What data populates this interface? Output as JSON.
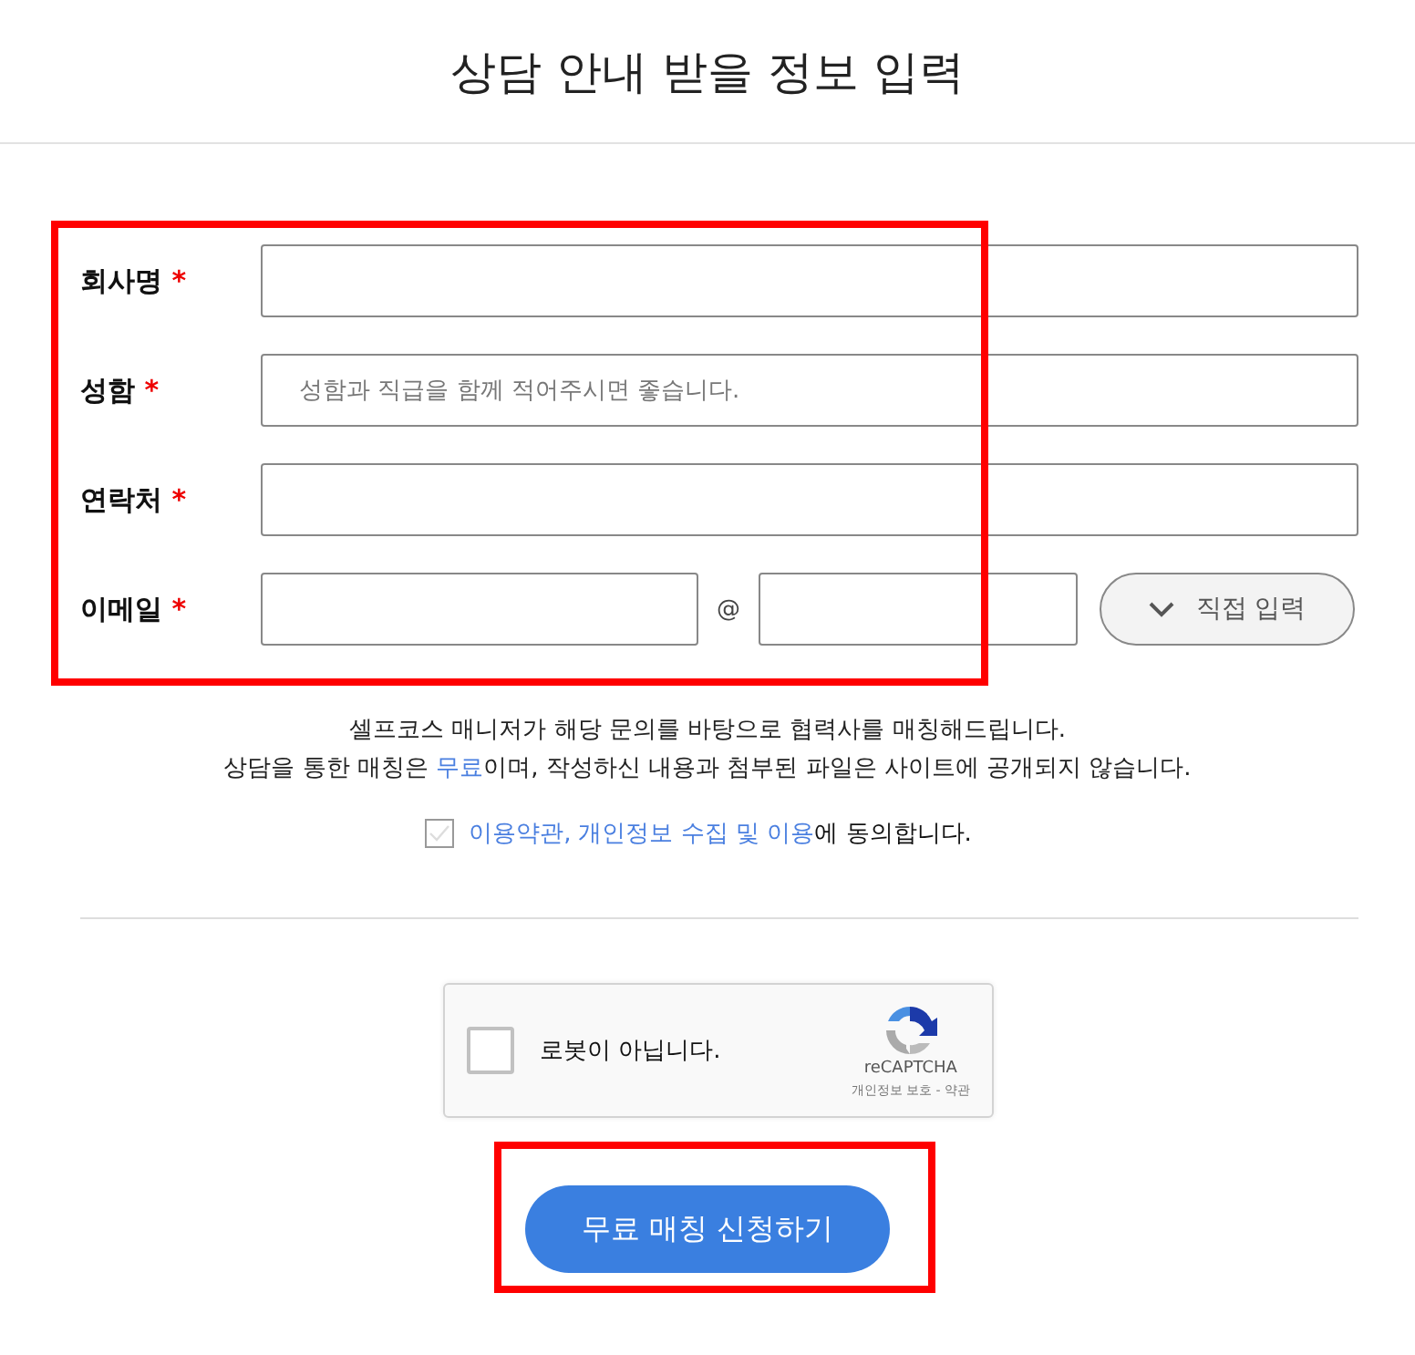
{
  "title": "상담 안내 받을 정보 입력",
  "fields": [
    {
      "label": "회사명",
      "required": "*",
      "kind": "text"
    },
    {
      "label": "성함",
      "required": "*",
      "kind": "text",
      "placeholder": "성함과 직급을 함께 적어주시면 좋습니다."
    },
    {
      "label": "연락처",
      "required": "*",
      "kind": "text"
    },
    {
      "label": "이메일",
      "required": "*",
      "kind": "email",
      "at": "@",
      "domain_button": "직접 입력"
    }
  ],
  "fields_highlighted": true,
  "notice": [
    [
      {
        "kind": "text",
        "text": "셀프코스 매니저가 해당 문의를 바탕으로 협력사를 매칭해드립니다."
      }
    ],
    [
      {
        "kind": "text",
        "text": "상담을 통한 매칭은 "
      },
      {
        "kind": "link",
        "text": "무료"
      },
      {
        "kind": "text",
        "text": "이며, 작성하신 내용과 첨부된 파일은 사이트에 공개되지 않습니다."
      }
    ]
  ],
  "agreement": {
    "checked": false,
    "parts": [
      {
        "kind": "link",
        "text": "이용약관,"
      },
      {
        "kind": "link",
        "text": "개인정보 수집 및 이용"
      },
      {
        "kind": "text",
        "text": "에 동의합니다."
      }
    ]
  },
  "captcha": {
    "checked": false,
    "label": "로봇이 아닙니다.",
    "brand": "reCAPTCHA",
    "links": "개인정보 보호 - 약관"
  },
  "submit": {
    "label": "무료 매칭 신청하기",
    "highlighted": true
  }
}
